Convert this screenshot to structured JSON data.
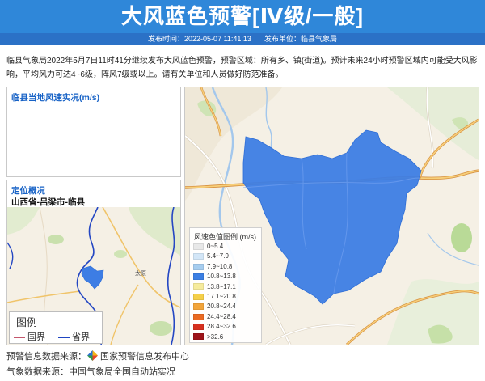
{
  "header": {
    "title": "大风蓝色预警[Ⅳ级/一般]",
    "publish_time": "发布时间：2022-05-07 11:41:13",
    "publisher": "发布单位：临县气象局"
  },
  "description": "临县气象局2022年5月7日11时41分继续发布大风蓝色预警，预警区域：所有乡、镇(街道)。预计未来24小时预警区域内可能受大风影响，平均风力可达4~6级，阵风7级或以上。请有关单位和人员做好防范准备。",
  "wind_panel": {
    "title": "临县当地风速实况(m/s)"
  },
  "location_panel": {
    "title": "定位概况",
    "region_path": "山西省-吕梁市-临县",
    "map_labels": [
      "太原"
    ],
    "legend": {
      "title": "图例",
      "items": [
        {
          "label": "国界",
          "color": "#c4566c"
        },
        {
          "label": "省界",
          "color": "#1f45c2"
        }
      ]
    }
  },
  "warning_map": {
    "area_color": "#3d7de4",
    "legend": {
      "title": "风速色值图例 (m/s)",
      "items": [
        {
          "label": "0~5.4",
          "color": "#e8e8e8"
        },
        {
          "label": "5.4~7.9",
          "color": "#d3e6f7"
        },
        {
          "label": "7.9~10.8",
          "color": "#a6cdef"
        },
        {
          "label": "10.8~13.8",
          "color": "#3c7fe3"
        },
        {
          "label": "13.8~17.1",
          "color": "#f6eb9c"
        },
        {
          "label": "17.1~20.8",
          "color": "#f5cf48"
        },
        {
          "label": "20.8~24.4",
          "color": "#f2a43a"
        },
        {
          "label": "24.4~28.4",
          "color": "#ea6a22"
        },
        {
          "label": "28.4~32.6",
          "color": "#d6301e"
        },
        {
          "label": ">32.6",
          "color": "#9e141a"
        }
      ]
    }
  },
  "footer": {
    "warning_source_label": "预警信息数据来源：",
    "warning_source": "国家预警信息发布中心",
    "warning_source_icon": "warning-center-logo-icon",
    "weather_source": "气象数据来源：中国气象局全国自动站实况"
  },
  "colors": {
    "header_bg": "#2f87d9",
    "subbar_bg": "#2b71c6",
    "panel_title": "#1762c6"
  }
}
